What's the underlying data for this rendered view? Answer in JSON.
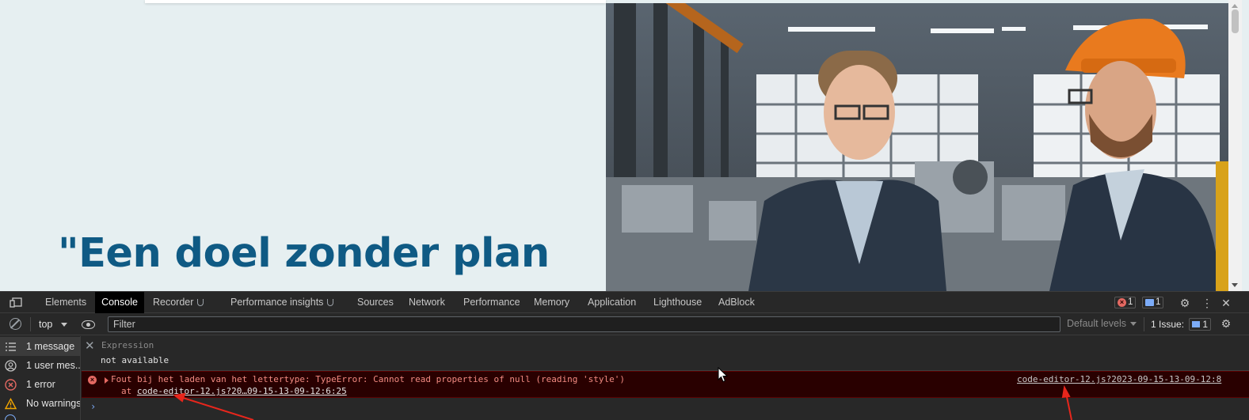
{
  "page": {
    "quote": "\"Een doel zonder plan"
  },
  "devtools": {
    "tabs": [
      {
        "label": "Elements"
      },
      {
        "label": "Console"
      },
      {
        "label": "Recorder"
      },
      {
        "label": "Performance insights"
      },
      {
        "label": "Sources"
      },
      {
        "label": "Network"
      },
      {
        "label": "Performance"
      },
      {
        "label": "Memory"
      },
      {
        "label": "Application"
      },
      {
        "label": "Lighthouse"
      },
      {
        "label": "AdBlock"
      }
    ],
    "error_count": "1",
    "message_count": "1",
    "context": "top",
    "filter_placeholder": "Filter",
    "levels": "Default levels",
    "issues_label": "1 Issue:",
    "issues_count": "1",
    "sidebar": [
      {
        "label": "1 message"
      },
      {
        "label": "1 user mes..."
      },
      {
        "label": "1 error"
      },
      {
        "label": "No warnings"
      }
    ],
    "expression_label": "Expression",
    "expression_value": "not available",
    "error": {
      "message": "Fout bij het laden van het lettertype: TypeError: Cannot read properties of null (reading 'style')",
      "stack_prefix": "at ",
      "stack_link": "code-editor-12.js?20…09-15-13-09-12:6:25",
      "source": "code-editor-12.js?2023-09-15-13-09-12:8"
    }
  },
  "colors": {
    "quote": "#0f5a84",
    "error_bg": "#290000",
    "error_text": "#f28b82",
    "annotation": "#e8261c"
  }
}
